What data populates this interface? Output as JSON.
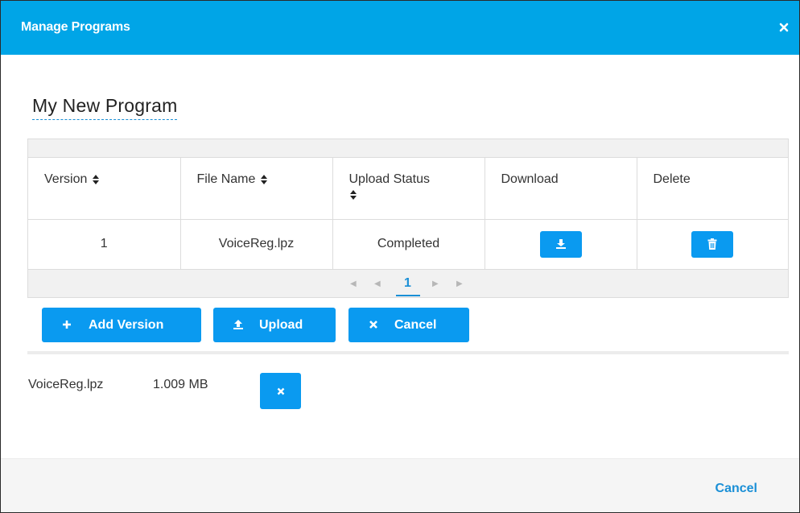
{
  "dialog": {
    "title": "Manage Programs",
    "program_name": "My New Program"
  },
  "grid": {
    "columns": [
      {
        "label": "Version",
        "sortable": true
      },
      {
        "label": "File Name",
        "sortable": true
      },
      {
        "label": "Upload Status",
        "sortable": true
      },
      {
        "label": "Download",
        "sortable": false
      },
      {
        "label": "Delete",
        "sortable": false
      }
    ],
    "rows": [
      {
        "version": "1",
        "file_name": "VoiceReg.lpz",
        "upload_status": "Completed"
      }
    ],
    "pager": {
      "current_page": "1"
    }
  },
  "actions": {
    "add_version": "Add Version",
    "upload": "Upload",
    "cancel": "Cancel"
  },
  "pending_upload": {
    "file_name": "VoiceReg.lpz",
    "file_size": "1.009 MB"
  },
  "footer": {
    "cancel": "Cancel"
  },
  "colors": {
    "header_bg": "#00a5e7",
    "button_bg": "#0a9af0",
    "link": "#1a8fd6"
  },
  "icons": {
    "close": "close-icon",
    "sort": "sort-icon",
    "download": "download-icon",
    "delete": "trash-icon",
    "add": "plus-icon",
    "upload": "upload-icon",
    "cancel": "x-icon"
  }
}
